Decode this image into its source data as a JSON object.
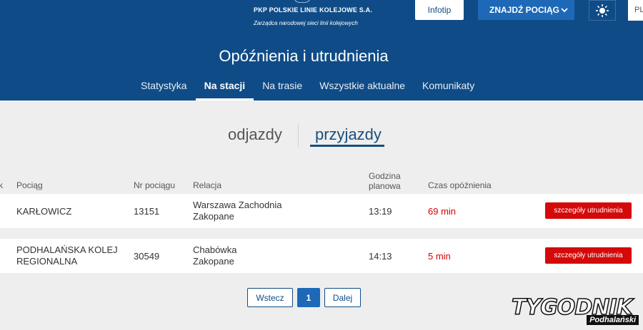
{
  "header": {
    "logo_text": "PKP POLSKIE LINIE KOLEJOWE S.A.",
    "logo_sub": "Zarządca narodowej sieci linii kolejowych",
    "infotip_label": "Infotip",
    "find_train_label": "ZNAJDŹ POCIĄG",
    "lang_label": "PL",
    "title": "Opóźnienia i utrudnienia",
    "tabs": [
      {
        "label": "Statystyka"
      },
      {
        "label": "Na stacji"
      },
      {
        "label": "Na trasie"
      },
      {
        "label": "Wszystkie aktualne"
      },
      {
        "label": "Komunikaty"
      }
    ],
    "active_tab": "Na stacji"
  },
  "toggle": {
    "departures": "odjazdy",
    "arrivals": "przyjazdy",
    "selected": "przyjazdy"
  },
  "table": {
    "edge_fragment": "k",
    "columns": {
      "train": "Pociąg",
      "number": "Nr pociągu",
      "route": "Relacja",
      "time_line1": "Godzina",
      "time_line2": "planowa",
      "delay": "Czas opóźnienia"
    },
    "rows": [
      {
        "train_line1": "KARŁOWICZ",
        "train_line2": "",
        "number": "13151",
        "route_from": "Warszawa Zachodnia",
        "route_to": "Zakopane",
        "time": "13:19",
        "delay": "69 min",
        "action": "szczegóły utrudnienia"
      },
      {
        "train_line1": "PODHALAŃSKA KOLEJ",
        "train_line2": "REGIONALNA",
        "number": "30549",
        "route_from": "Chabówka",
        "route_to": "Zakopane",
        "time": "14:13",
        "delay": "5 min",
        "action": "szczegóły utrudnienia"
      }
    ]
  },
  "pagination": {
    "prev": "Wstecz",
    "current": "1",
    "next": "Dalej"
  },
  "watermark": {
    "main": "TYGODNIK",
    "sub": "Podhalański"
  },
  "colors": {
    "header_bg": "#0f4c87",
    "accent_blue": "#1d69b8",
    "delay_red": "#d40000",
    "button_red": "#d40a0a"
  }
}
